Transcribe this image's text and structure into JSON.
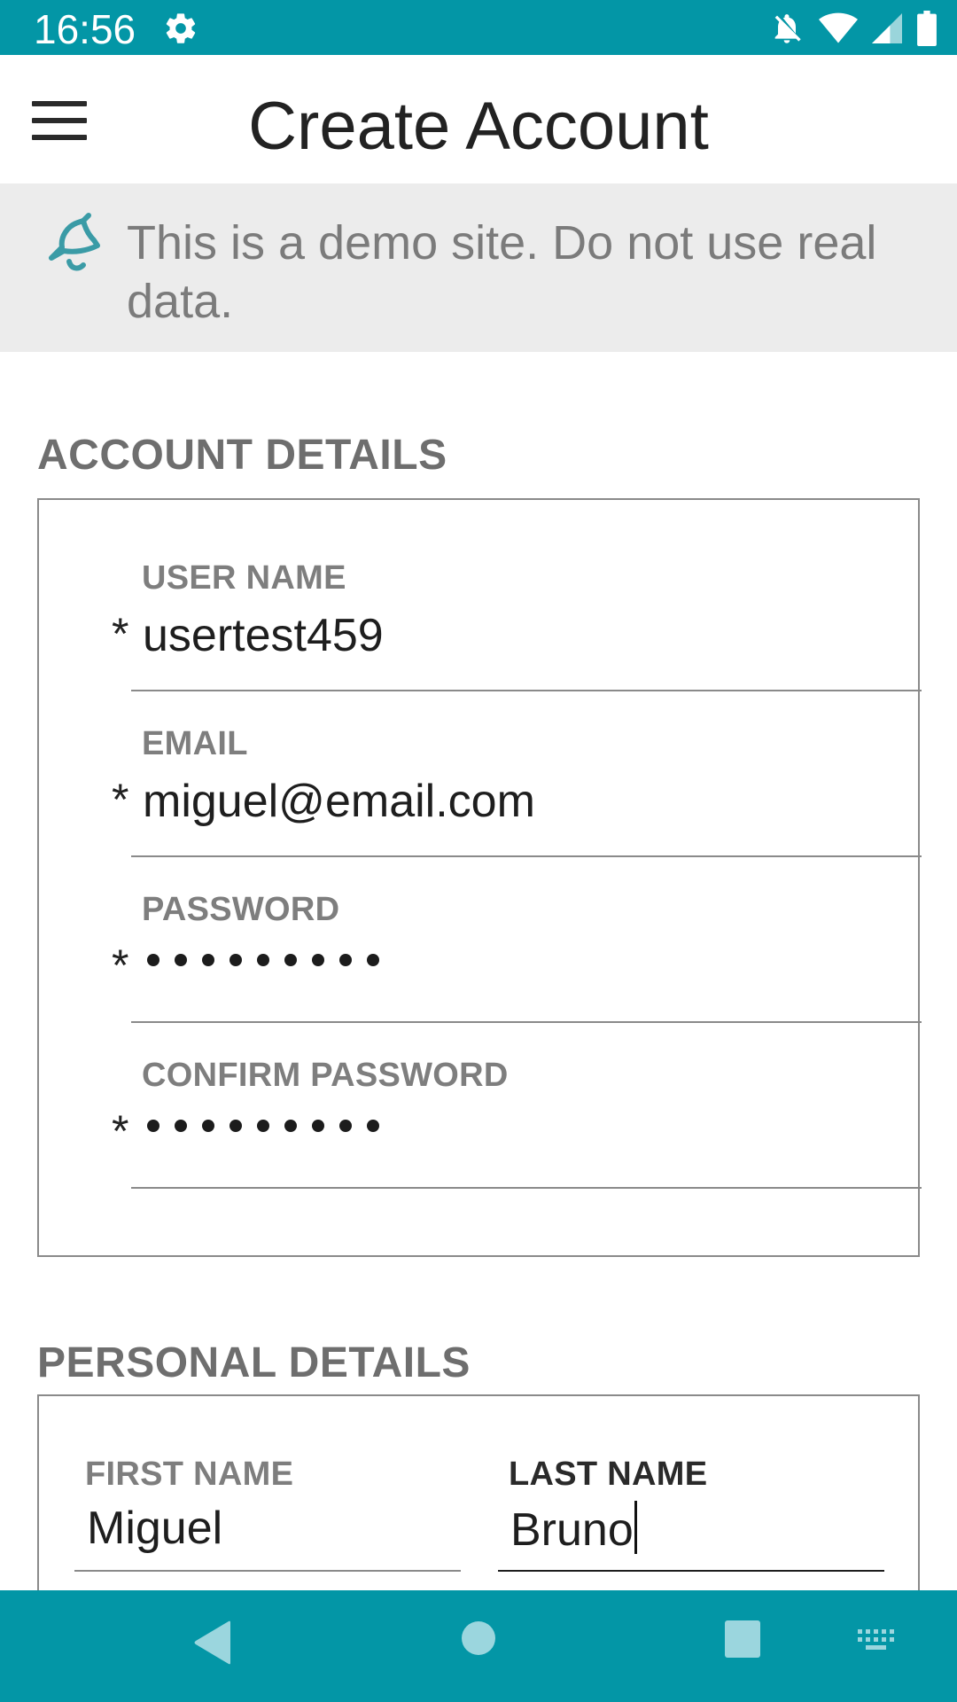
{
  "status_bar": {
    "time": "16:56",
    "icons": [
      "gear-icon",
      "notifications-off-icon",
      "wifi-icon",
      "signal-icon",
      "battery-icon"
    ]
  },
  "app_bar": {
    "title": "Create Account",
    "menu_icon": "hamburger-menu-icon"
  },
  "banner": {
    "icon": "bell-icon",
    "text": "This is a demo site. Do not use real data."
  },
  "account_details": {
    "title": "ACCOUNT DETAILS",
    "fields": [
      {
        "label": "USER NAME",
        "value": "usertest459",
        "required": "*"
      },
      {
        "label": "EMAIL",
        "value": "miguel@email.com",
        "required": "*"
      },
      {
        "label": "PASSWORD",
        "value": "•••••••••",
        "required": "*"
      },
      {
        "label": "CONFIRM PASSWORD",
        "value": "•••••••••",
        "required": "*"
      }
    ]
  },
  "personal_details": {
    "title": "PERSONAL DETAILS",
    "first_name": {
      "label": "FIRST NAME",
      "value": "Miguel"
    },
    "last_name": {
      "label": "LAST NAME",
      "value": "Bruno"
    }
  },
  "nav_bar": {
    "buttons": [
      "back-icon",
      "home-icon",
      "recents-icon",
      "keyboard-icon"
    ]
  },
  "colors": {
    "accent": "#0396A6",
    "banner_bg": "#ECECEC",
    "section_title": "#6E6E6E"
  }
}
